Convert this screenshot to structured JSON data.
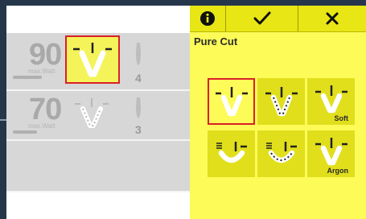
{
  "left": {
    "row1": {
      "watt": "90",
      "unit": "max.Watt",
      "effect": "4"
    },
    "row2": {
      "watt": "70",
      "unit": "max.Watt",
      "effect": "3"
    }
  },
  "toolbar": {
    "buttons": [
      {
        "icon": "info-icon",
        "label": ""
      },
      {
        "icon": "check-icon",
        "label": ""
      },
      {
        "icon": "close-icon",
        "label": ""
      }
    ]
  },
  "panel": {
    "title": "Pure Cut",
    "modes": [
      {
        "icon": "pure-cut-icon",
        "label": "",
        "selected": true
      },
      {
        "icon": "blend-cut-icon",
        "label": "",
        "selected": false
      },
      {
        "icon": "soft-cut-icon",
        "label": "Soft",
        "selected": false
      },
      {
        "icon": "coag-icon",
        "label": "",
        "selected": false
      },
      {
        "icon": "coag-dotted-icon",
        "label": "",
        "selected": false
      },
      {
        "icon": "argon-icon",
        "label": "Argon",
        "selected": false
      }
    ]
  },
  "colors": {
    "accent": "#fdfb57",
    "toolbar": "#e8e614",
    "selection": "#d8202a",
    "frame": "#25364a"
  }
}
